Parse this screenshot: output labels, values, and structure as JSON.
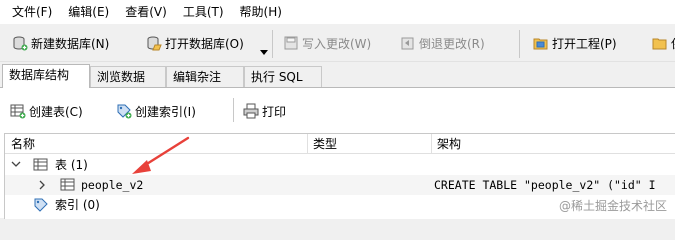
{
  "menu": [
    "文件(F)",
    "编辑(E)",
    "查看(V)",
    "工具(T)",
    "帮助(H)"
  ],
  "toolbar": {
    "new_db": "新建数据库(N)",
    "open_db": "打开数据库(O)",
    "write_changes": "写入更改(W)",
    "revert_changes": "倒退更改(R)",
    "open_project": "打开工程(P)",
    "partial": "保"
  },
  "tabs": [
    "数据库结构",
    "浏览数据",
    "编辑杂注",
    "执行 SQL"
  ],
  "structure_toolbar": {
    "create_table": "创建表(C)",
    "create_index": "创建索引(I)",
    "print": "打印"
  },
  "grid": {
    "headers": [
      "名称",
      "类型",
      "架构"
    ],
    "tables_node": "表 (1)",
    "table_name": "people_v2",
    "table_schema": "CREATE TABLE \"people_v2\" (\"id\" I",
    "indexes_node": "索引 (0)"
  },
  "watermark": "@稀土掘金技术社区",
  "colors": {
    "arrow": "#e8413a",
    "accent_blue": "#2f6fb5"
  }
}
